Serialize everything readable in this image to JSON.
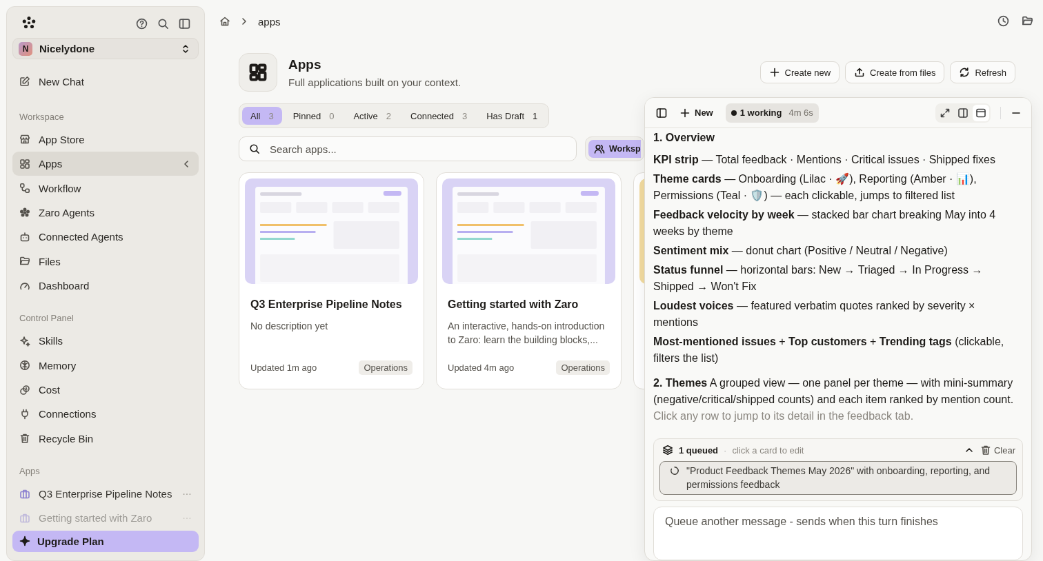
{
  "sidebar": {
    "workspace_name": "Nicelydone",
    "workspace_initial": "N",
    "new_chat": "New Chat",
    "sections": [
      {
        "title": "Workspace",
        "items": [
          {
            "label": "App Store",
            "selected": false
          },
          {
            "label": "Apps",
            "selected": true
          },
          {
            "label": "Workflow",
            "selected": false
          },
          {
            "label": "Zaro Agents",
            "selected": false
          },
          {
            "label": "Connected Agents",
            "selected": false
          },
          {
            "label": "Files",
            "selected": false
          },
          {
            "label": "Dashboard",
            "selected": false
          }
        ]
      },
      {
        "title": "Control Panel",
        "items": [
          {
            "label": "Skills",
            "selected": false
          },
          {
            "label": "Memory",
            "selected": false
          },
          {
            "label": "Cost",
            "selected": false
          },
          {
            "label": "Connections",
            "selected": false
          },
          {
            "label": "Recycle Bin",
            "selected": false
          }
        ]
      }
    ],
    "apps_title": "Apps",
    "apps": [
      {
        "label": "Q3 Enterprise Pipeline Notes",
        "dimmed": false
      },
      {
        "label": "Getting started with Zaro",
        "dimmed": true
      }
    ],
    "upgrade": "Upgrade Plan"
  },
  "breadcrumb": {
    "current": "apps"
  },
  "header": {
    "title": "Apps",
    "subtitle": "Full applications built on your context.",
    "buttons": [
      "Create new",
      "Create from files",
      "Refresh"
    ]
  },
  "filters": [
    {
      "label": "All",
      "count": "3",
      "selected": true
    },
    {
      "label": "Pinned",
      "count": "0",
      "selected": false
    },
    {
      "label": "Active",
      "count": "2",
      "selected": false
    },
    {
      "label": "Connected",
      "count": "3",
      "selected": false
    },
    {
      "label": "Has Draft",
      "count": "1",
      "selected": false
    }
  ],
  "search": {
    "placeholder": "Search apps..."
  },
  "scope_button": "Worksp",
  "cards": [
    {
      "kind": "app",
      "title": "Q3 Enterprise Pipeline Notes",
      "description": "No description yet",
      "updated": "Updated 1m ago",
      "tag": "Operations"
    },
    {
      "kind": "app",
      "title": "Getting started with Zaro",
      "description": "An interactive, hands-on introduction to Zaro: learn the building blocks,...",
      "updated": "Updated 4m ago",
      "tag": "Operations"
    },
    {
      "kind": "picture"
    }
  ],
  "chat": {
    "new": "New",
    "status": "1 working",
    "elapsed": "4m 6s",
    "messages": [
      {
        "kind": "heading",
        "text": "1. Overview"
      },
      {
        "kind": "line",
        "text": "**KPI strip** — Total feedback · Mentions · Critical issues · Shipped fixes"
      },
      {
        "kind": "line",
        "text": "**Theme cards** — Onboarding (Lilac · 🚀), Reporting (Amber · 📊), Permissions (Teal · 🛡️) — each clickable, jumps to filtered list"
      },
      {
        "kind": "line",
        "text": "**Feedback velocity by week** — stacked bar chart breaking May into 4 weeks by theme"
      },
      {
        "kind": "line",
        "text": "**Sentiment mix** — donut chart (Positive / Neutral / Negative)"
      },
      {
        "kind": "line",
        "text": "**Status funnel** — horizontal bars: New → Triaged → In Progress → Shipped → Won't Fix"
      },
      {
        "kind": "line",
        "text": "**Loudest voices** — featured verbatim quotes ranked by severity × mentions"
      },
      {
        "kind": "line",
        "text": "**Most-mentioned issues** + **Top customers** + **Trending tags** (clickable, filters the list)"
      },
      {
        "kind": "para",
        "text": "**2. Themes** A grouped view — one panel per theme — with mini-summary (negative/critical/shipped counts) and each item ranked by mention count."
      },
      {
        "kind": "muted",
        "text": "Click any row to jump to its detail in the feedback tab."
      }
    ],
    "queue": {
      "count": "1 queued",
      "separator": "·",
      "hint": "click a card to edit",
      "clear": "Clear",
      "items": [
        "\"Product Feedback Themes May 2026\" with onboarding, reporting, and permissions feedback"
      ]
    },
    "input": {
      "placeholder": "Queue another message - sends when this turn finishes"
    }
  }
}
